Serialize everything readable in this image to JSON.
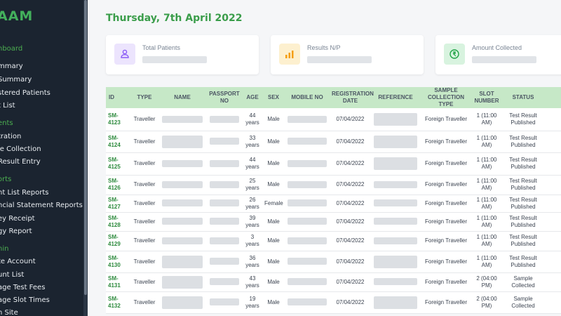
{
  "sidebar": {
    "logo": "AAM",
    "items": [
      {
        "label": "hboard",
        "style": "green"
      },
      {
        "label": "mmary",
        "style": "white"
      },
      {
        "label": "Summary",
        "style": "white"
      },
      {
        "label": "stered Patients",
        "style": "white"
      },
      {
        "label": "t List",
        "style": "white"
      },
      {
        "label": "ents",
        "style": "green"
      },
      {
        "label": "tration",
        "style": "white"
      },
      {
        "label": "le Collection",
        "style": "white"
      },
      {
        "label": "Result Entry",
        "style": "white"
      },
      {
        "label": "orts",
        "style": "green"
      },
      {
        "label": "nt List Reports",
        "style": "white"
      },
      {
        "label": "ncial Statement Reports",
        "style": "white"
      },
      {
        "label": "ey Receipt",
        "style": "white"
      },
      {
        "label": "gy Report",
        "style": "white"
      },
      {
        "label": "nin",
        "style": "green"
      },
      {
        "label": "te Account",
        "style": "white"
      },
      {
        "label": "unt List",
        "style": "white"
      },
      {
        "label": "age Test Fees",
        "style": "white"
      },
      {
        "label": "age Slot Times",
        "style": "white"
      },
      {
        "label": "n Site",
        "style": "white"
      }
    ]
  },
  "header": {
    "date": "Thursday, 7th April 2022"
  },
  "cards": [
    {
      "label": "Total Patients",
      "icon": "users-icon",
      "color": "#8b5cf6"
    },
    {
      "label": "Results N/P",
      "icon": "bar-chart-icon",
      "color": "#f59e0b"
    },
    {
      "label": "Amount Collected",
      "icon": "currency-icon",
      "color": "#22a447"
    }
  ],
  "table": {
    "headers": [
      "ID",
      "TYPE",
      "NAME",
      "PASSPORT NO",
      "AGE",
      "SEX",
      "MOBILE NO",
      "REGISTRATION DATE",
      "REFERENCE",
      "SAMPLE COLLECTION TYPE",
      "SLOT NUMBER",
      "STATUS"
    ],
    "rows": [
      {
        "id": "SM-4123",
        "type": "Traveller",
        "age": "44 years",
        "sex": "Male",
        "date": "07/04/2022",
        "collection": "Foreign Traveller",
        "slot": "1 (11:00 AM)",
        "status": "Test Result Published"
      },
      {
        "id": "SM-4124",
        "type": "Traveller",
        "age": "33 years",
        "sex": "Male",
        "date": "07/04/2022",
        "collection": "Foreign Traveller",
        "slot": "1 (11:00 AM)",
        "status": "Test Result Published"
      },
      {
        "id": "SM-4125",
        "type": "Traveller",
        "age": "44 years",
        "sex": "Male",
        "date": "07/04/2022",
        "collection": "Foreign Traveller",
        "slot": "1 (11:00 AM)",
        "status": "Test Result Published"
      },
      {
        "id": "SM-4126",
        "type": "Traveller",
        "age": "25 years",
        "sex": "Male",
        "date": "07/04/2022",
        "collection": "Foreign Traveller",
        "slot": "1 (11:00 AM)",
        "status": "Test Result Published"
      },
      {
        "id": "SM-4127",
        "type": "Traveller",
        "age": "26 years",
        "sex": "Female",
        "date": "07/04/2022",
        "collection": "Foreign Traveller",
        "slot": "1 (11:00 AM)",
        "status": "Test Result Published"
      },
      {
        "id": "SM-4128",
        "type": "Traveller",
        "age": "39 years",
        "sex": "Male",
        "date": "07/04/2022",
        "collection": "Foreign Traveller",
        "slot": "1 (11:00 AM)",
        "status": "Test Result Published"
      },
      {
        "id": "SM-4129",
        "type": "Traveller",
        "age": "3 years",
        "sex": "Male",
        "date": "07/04/2022",
        "collection": "Foreign Traveller",
        "slot": "1 (11:00 AM)",
        "status": "Test Result Published"
      },
      {
        "id": "SM-4130",
        "type": "Traveller",
        "age": "36 years",
        "sex": "Male",
        "date": "07/04/2022",
        "collection": "Foreign Traveller",
        "slot": "1 (11:00 AM)",
        "status": "Test Result Published"
      },
      {
        "id": "SM-4131",
        "type": "Traveller",
        "age": "43 years",
        "sex": "Male",
        "date": "07/04/2022",
        "collection": "Foreign Traveller",
        "slot": "2 (04:00 PM)",
        "status": "Sample Collected"
      },
      {
        "id": "SM-4132",
        "type": "Traveller",
        "age": "19 years",
        "sex": "Male",
        "date": "07/04/2022",
        "collection": "Foreign Traveller",
        "slot": "2 (04:00 PM)",
        "status": "Sample Collected"
      }
    ]
  }
}
